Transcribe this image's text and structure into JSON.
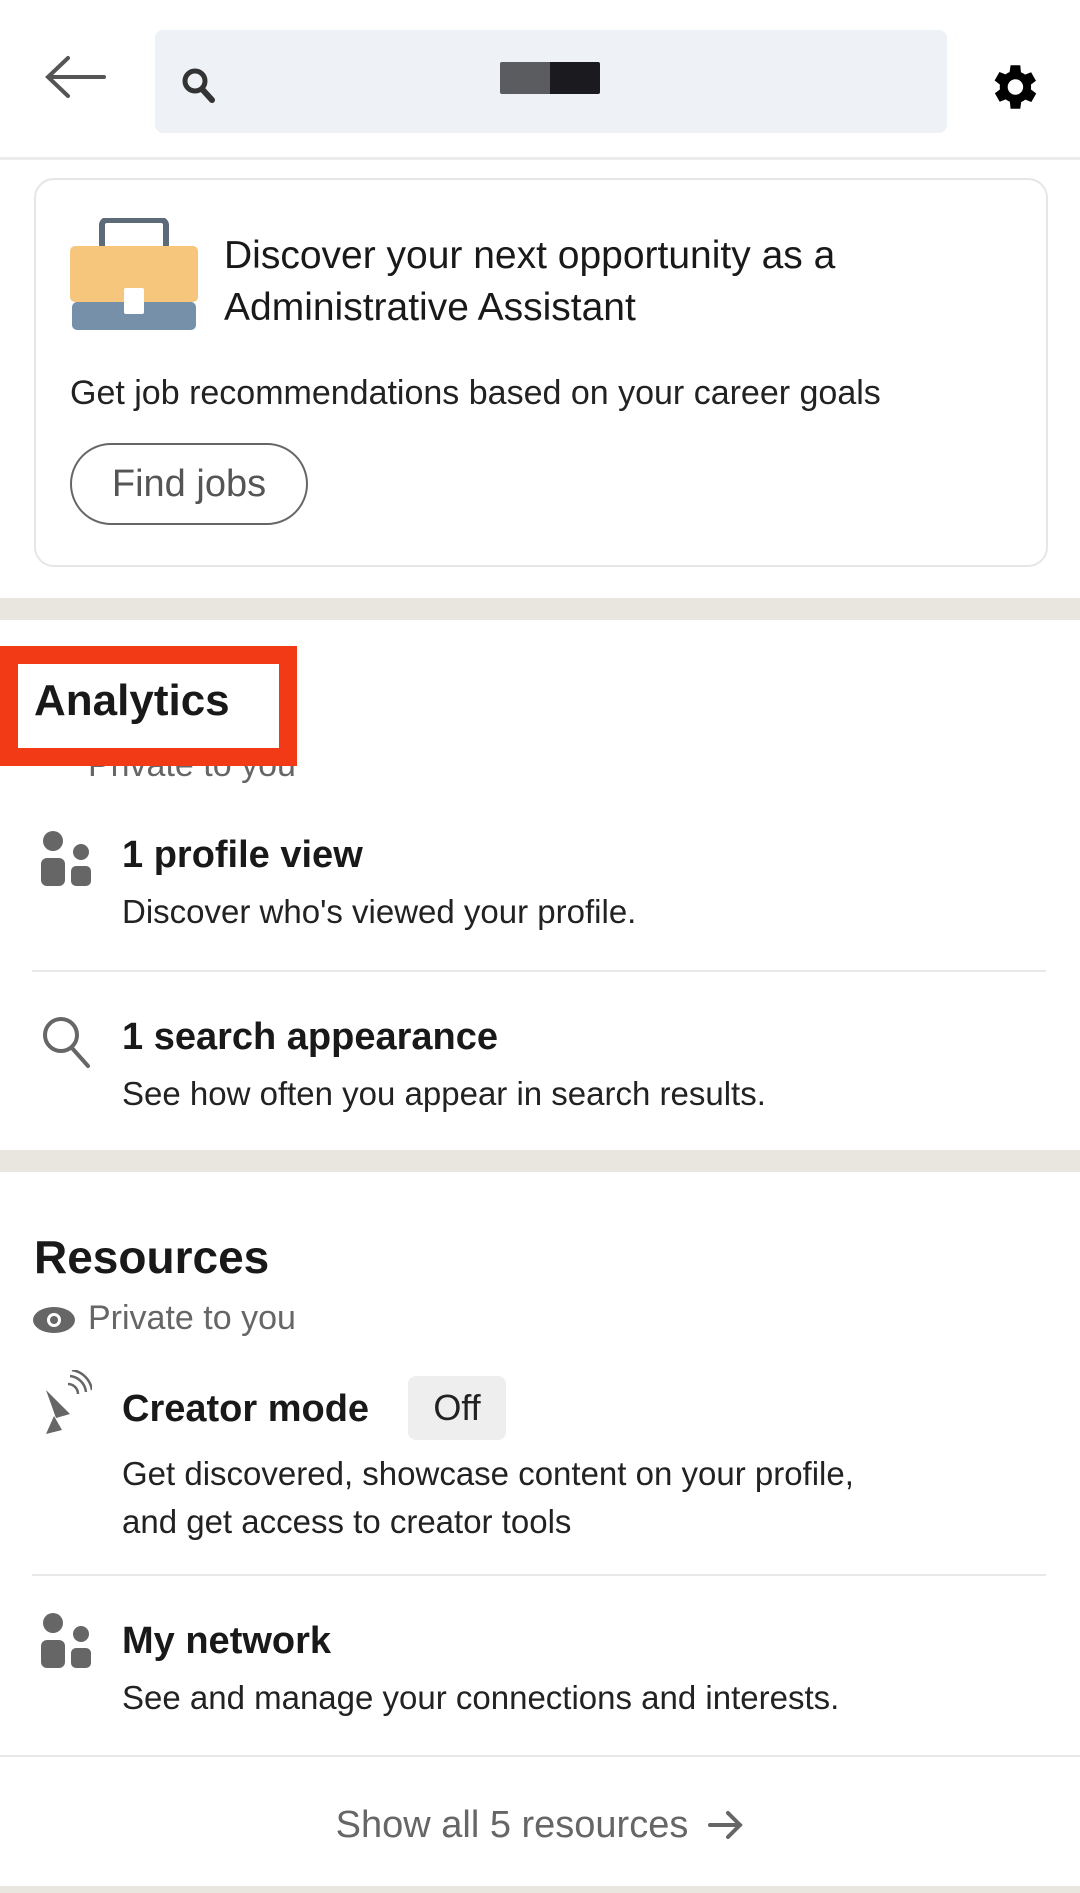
{
  "header": {
    "back_icon": "arrow-left-icon",
    "search_icon": "search-icon",
    "search_value_redacted": true,
    "settings_icon": "gear-icon"
  },
  "job_card": {
    "icon": "briefcase-icon",
    "title_line1": "Discover your next opportunity as a",
    "title_line2": "Administrative Assistant",
    "subtitle": "Get job recommendations based on your career goals",
    "button_label": "Find jobs"
  },
  "analytics": {
    "heading": "Analytics",
    "privacy": "Private to you",
    "highlight_color": "#f23a16",
    "items": [
      {
        "icon": "people-icon",
        "title": "1 profile view",
        "description": "Discover who's viewed your profile."
      },
      {
        "icon": "search-icon",
        "title": "1 search appearance",
        "description": "See how often you appear in search results."
      }
    ]
  },
  "resources": {
    "heading": "Resources",
    "privacy": "Private to you",
    "items": [
      {
        "icon": "satellite-dish-icon",
        "title": "Creator mode",
        "badge": "Off",
        "description_line1": "Get discovered, showcase content on your profile,",
        "description_line2": "and get access to creator tools"
      },
      {
        "icon": "people-icon",
        "title": "My network",
        "description": "See and manage your connections and interests."
      }
    ],
    "show_all": "Show all 5 resources"
  }
}
